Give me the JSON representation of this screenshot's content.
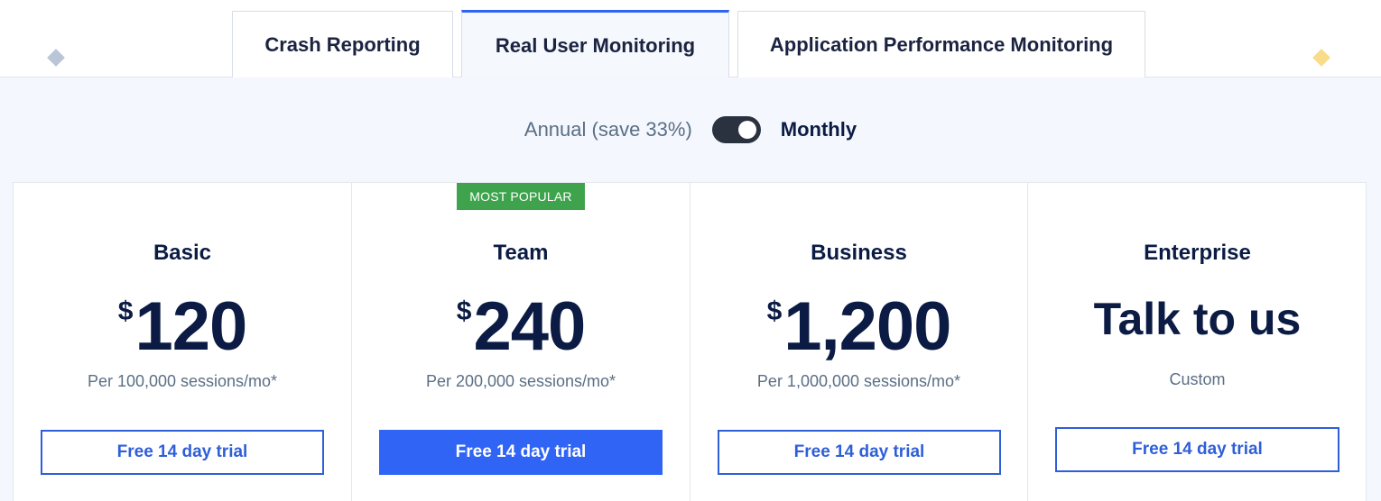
{
  "tabs": [
    {
      "label": "Crash Reporting",
      "active": false
    },
    {
      "label": "Real User Monitoring",
      "active": true
    },
    {
      "label": "Application Performance Monitoring",
      "active": false
    }
  ],
  "billing": {
    "annual_label": "Annual (save 33%)",
    "monthly_label": "Monthly",
    "selected": "Monthly"
  },
  "plans": [
    {
      "name": "Basic",
      "currency": "$",
      "price": "120",
      "unit": "Per 100,000 sessions/mo*",
      "cta": "Free 14 day trial"
    },
    {
      "name": "Team",
      "badge": "MOST POPULAR",
      "currency": "$",
      "price": "240",
      "unit": "Per 200,000 sessions/mo*",
      "cta": "Free 14 day trial"
    },
    {
      "name": "Business",
      "currency": "$",
      "price": "1,200",
      "unit": "Per 1,000,000 sessions/mo*",
      "cta": "Free 14 day trial"
    },
    {
      "name": "Enterprise",
      "headline": "Talk to us",
      "unit": "Custom",
      "cta": "Free 14 day trial"
    }
  ],
  "colors": {
    "accent": "#2f64f5",
    "badge": "#3fa34d",
    "text_dark": "#0b1b44",
    "text_muted": "#5a6f85",
    "background": "#f4f7fd"
  }
}
